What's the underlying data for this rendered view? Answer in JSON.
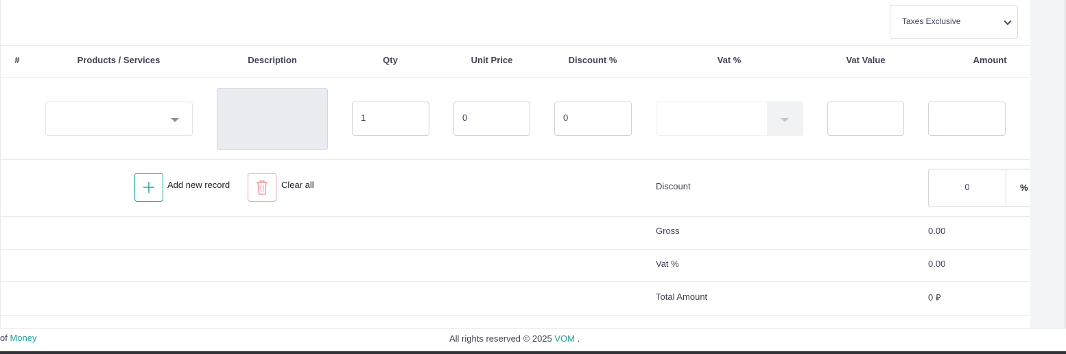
{
  "tax_mode": {
    "selected": "Taxes Exclusive"
  },
  "table": {
    "headers": [
      "#",
      "Products / Services",
      "Description",
      "Qty",
      "Unit Price",
      "Discount %",
      "Vat %",
      "Vat Value",
      "Amount"
    ],
    "row": {
      "product": "",
      "description": "",
      "qty": "1",
      "unit_price": "0",
      "discount_pct": "0",
      "vat_pct": "",
      "vat_value": "",
      "amount": ""
    }
  },
  "actions": {
    "add_label": "Add new record",
    "clear_label": "Clear all"
  },
  "summary": {
    "discount_label": "Discount",
    "discount_value": "0",
    "discount_type": "% ·",
    "gross_label": "Gross",
    "gross_value": "0.00",
    "vat_label": "Vat %",
    "vat_value": "0.00",
    "total_label": "Total Amount",
    "total_value": "0",
    "currency_symbol": "⃁"
  },
  "footer": {
    "left_prefix": "of",
    "left_link": "Money",
    "rights_text": "All rights reserved © 2025",
    "brand_link": "VOM",
    "suffix": "."
  },
  "colors": {
    "accent": "#1aa39a",
    "danger": "#f3a3a8",
    "text": "#3f4254"
  }
}
